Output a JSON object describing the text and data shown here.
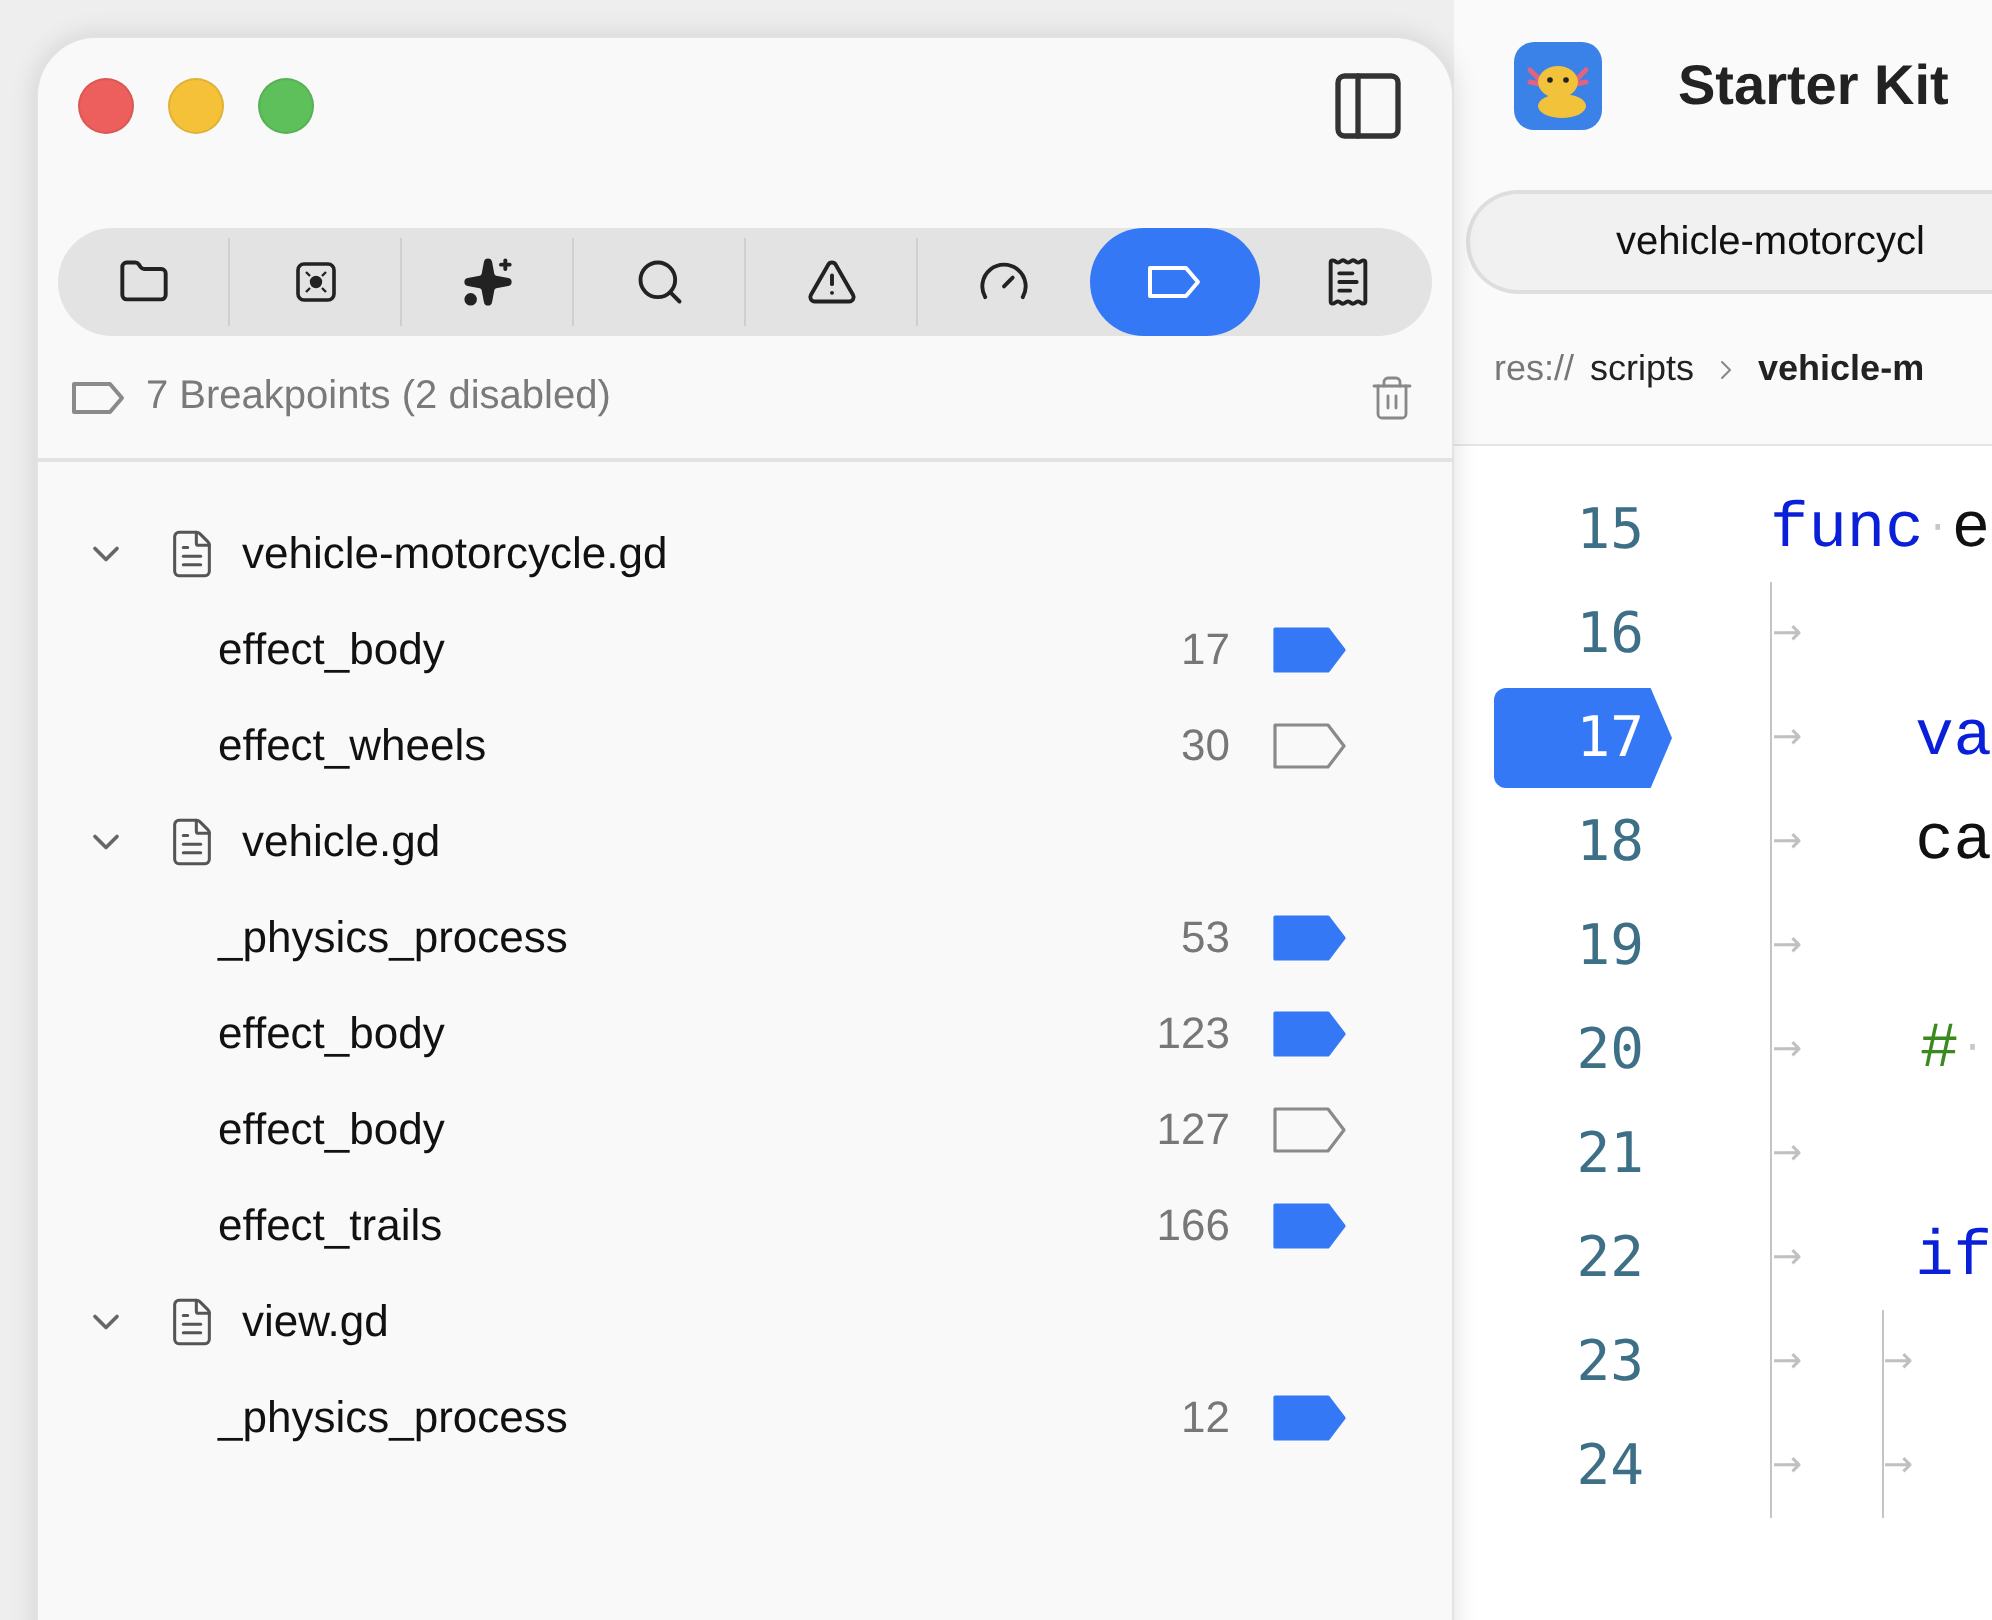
{
  "sidebar": {
    "tabs": [
      {
        "selected": false
      },
      {
        "selected": false
      },
      {
        "selected": false
      },
      {
        "selected": false
      },
      {
        "selected": false
      },
      {
        "selected": false
      },
      {
        "selected": true
      },
      {
        "selected": false
      }
    ],
    "summary": "7 Breakpoints (2 disabled)",
    "files": [
      {
        "name": "vehicle-motorcycle.gd",
        "expanded": true,
        "breakpoints": [
          {
            "name": "effect_body",
            "line": "17",
            "enabled": true
          },
          {
            "name": "effect_wheels",
            "line": "30",
            "enabled": false
          }
        ]
      },
      {
        "name": "vehicle.gd",
        "expanded": true,
        "breakpoints": [
          {
            "name": "_physics_process",
            "line": "53",
            "enabled": true
          },
          {
            "name": "effect_body",
            "line": "123",
            "enabled": true
          },
          {
            "name": "effect_body",
            "line": "127",
            "enabled": false
          },
          {
            "name": "effect_trails",
            "line": "166",
            "enabled": true
          }
        ]
      },
      {
        "name": "view.gd",
        "expanded": true,
        "breakpoints": [
          {
            "name": "_physics_process",
            "line": "12",
            "enabled": true
          }
        ]
      }
    ]
  },
  "editor": {
    "title": "Starter Kit",
    "tab": "vehicle-motorcycl",
    "breadcrumb": [
      {
        "kind": "root",
        "text": "res://"
      },
      {
        "kind": "folder",
        "text": "scripts"
      },
      {
        "kind": "file",
        "text": "vehicle-m"
      }
    ],
    "lines": [
      {
        "number": "15",
        "breakpoint": false,
        "tokens": [
          {
            "kind": "keyword",
            "text": "func"
          },
          {
            "kind": "space",
            "text": "·"
          },
          {
            "kind": "plain",
            "text": "e"
          }
        ]
      },
      {
        "number": "16",
        "breakpoint": false,
        "tokens": [
          {
            "kind": "tab",
            "text": "→"
          }
        ]
      },
      {
        "number": "17",
        "breakpoint": true,
        "tokens": [
          {
            "kind": "tab",
            "text": "→"
          },
          {
            "kind": "keyword",
            "text": "va"
          }
        ]
      },
      {
        "number": "18",
        "breakpoint": false,
        "tokens": [
          {
            "kind": "tab",
            "text": "→"
          },
          {
            "kind": "plain",
            "text": "ca"
          }
        ]
      },
      {
        "number": "19",
        "breakpoint": false,
        "tokens": [
          {
            "kind": "tab",
            "text": "→"
          }
        ]
      },
      {
        "number": "20",
        "breakpoint": false,
        "tokens": [
          {
            "kind": "tab",
            "text": "→"
          },
          {
            "kind": "comment",
            "text": "#"
          },
          {
            "kind": "space",
            "text": "·"
          }
        ]
      },
      {
        "number": "21",
        "breakpoint": false,
        "tokens": [
          {
            "kind": "tab",
            "text": "→"
          }
        ]
      },
      {
        "number": "22",
        "breakpoint": false,
        "tokens": [
          {
            "kind": "tab",
            "text": "→"
          },
          {
            "kind": "keyword",
            "text": "if"
          }
        ]
      },
      {
        "number": "23",
        "breakpoint": false,
        "tokens": [
          {
            "kind": "tab",
            "text": "→"
          },
          {
            "kind": "tab",
            "text": "→"
          }
        ]
      },
      {
        "number": "24",
        "breakpoint": false,
        "tokens": [
          {
            "kind": "tab",
            "text": "→"
          },
          {
            "kind": "tab",
            "text": "→"
          }
        ]
      }
    ]
  }
}
